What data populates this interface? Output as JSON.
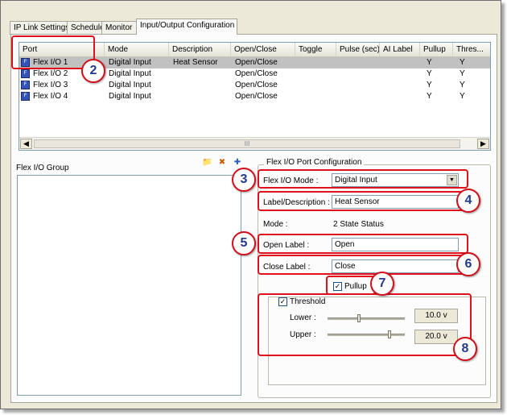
{
  "tabs": [
    "IP Link Settings",
    "Schedule",
    "Monitor",
    "Input/Output Configuration"
  ],
  "table": {
    "columns": [
      "Port",
      "Mode",
      "Description",
      "Open/Close",
      "Toggle",
      "Pulse (sec)",
      "AI Label",
      "Pullup",
      "Thres..."
    ],
    "rows": [
      {
        "port": "Flex I/O 1",
        "mode": "Digital Input",
        "description": "Heat Sensor",
        "open_close": "Open/Close",
        "pullup": "Y",
        "threshold": "Y"
      },
      {
        "port": "Flex I/O 2",
        "mode": "Digital Input",
        "description": "",
        "open_close": "Open/Close",
        "pullup": "Y",
        "threshold": "Y"
      },
      {
        "port": "Flex I/O 3",
        "mode": "Digital Input",
        "description": "",
        "open_close": "Open/Close",
        "pullup": "Y",
        "threshold": "Y"
      },
      {
        "port": "Flex I/O 4",
        "mode": "Digital Input",
        "description": "",
        "open_close": "Open/Close",
        "pullup": "Y",
        "threshold": "Y"
      }
    ],
    "scroll_thumb_glyph": "III"
  },
  "group": {
    "label": "Flex I/O Group"
  },
  "config": {
    "legend": "Flex I/O Port Configuration",
    "mode_label": "Flex I/O Mode :",
    "mode_value": "Digital Input",
    "desc_label": "Label/Description :",
    "desc_value": "Heat Sensor",
    "mode_static_label": "Mode :",
    "mode_static_value": "2 State Status",
    "open_label": "Open Label :",
    "open_value": "Open",
    "close_label": "Close Label :",
    "close_value": "Close",
    "pullup_label": "Pullup",
    "threshold_label": "Threshold",
    "lower_label": "Lower :",
    "lower_value": "10.0 v",
    "upper_label": "Upper :",
    "upper_value": "20.0 v"
  },
  "callouts": [
    "2",
    "3",
    "4",
    "5",
    "6",
    "7",
    "8"
  ],
  "colors": {
    "highlight": "#e0101c",
    "badge_text": "#223a8a",
    "selected_row": "#c1c1c1"
  }
}
